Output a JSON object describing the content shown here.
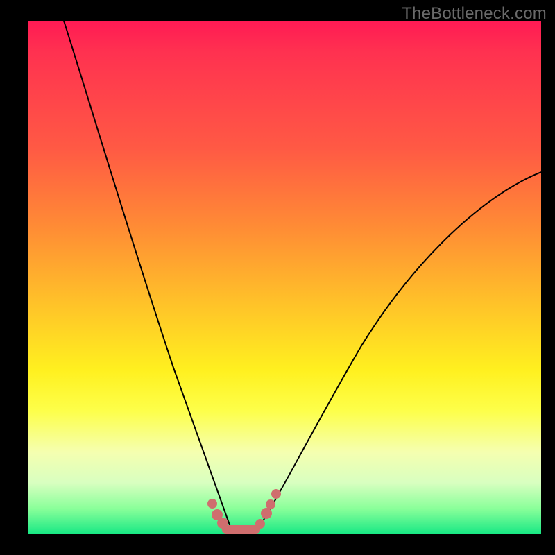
{
  "watermark": "TheBottleneck.com",
  "chart_data": {
    "type": "line",
    "title": "",
    "xlabel": "",
    "ylabel": "",
    "xlim": [
      0,
      100
    ],
    "ylim": [
      0,
      100
    ],
    "gradient_stops": [
      {
        "pct": 0,
        "color": "#ff1a54"
      },
      {
        "pct": 25,
        "color": "#ff5a44"
      },
      {
        "pct": 55,
        "color": "#ffc229"
      },
      {
        "pct": 76,
        "color": "#fdff4a"
      },
      {
        "pct": 90,
        "color": "#d8ffc0"
      },
      {
        "pct": 100,
        "color": "#17e884"
      }
    ],
    "series": [
      {
        "name": "bottleneck-curve-left",
        "x": [
          7,
          10,
          14,
          18,
          22,
          26,
          30,
          33,
          36,
          38,
          39.5
        ],
        "y": [
          100,
          86,
          70,
          56,
          43,
          32,
          22,
          14,
          8,
          3,
          0
        ]
      },
      {
        "name": "bottleneck-curve-right",
        "x": [
          44,
          46,
          49,
          53,
          58,
          64,
          71,
          79,
          88,
          98
        ],
        "y": [
          0,
          3,
          8,
          15,
          23,
          32,
          42,
          52,
          61,
          70
        ]
      }
    ],
    "marker_points": {
      "name": "highlight-dots",
      "color": "#cf6e6e",
      "x": [
        36,
        37.2,
        38.5,
        39.8,
        41,
        42.2,
        43.4,
        44.6,
        45.8,
        47,
        48.2
      ],
      "y": [
        6,
        3.5,
        1.5,
        0.5,
        0,
        0,
        0.5,
        1.5,
        3,
        5,
        7.5
      ]
    }
  }
}
